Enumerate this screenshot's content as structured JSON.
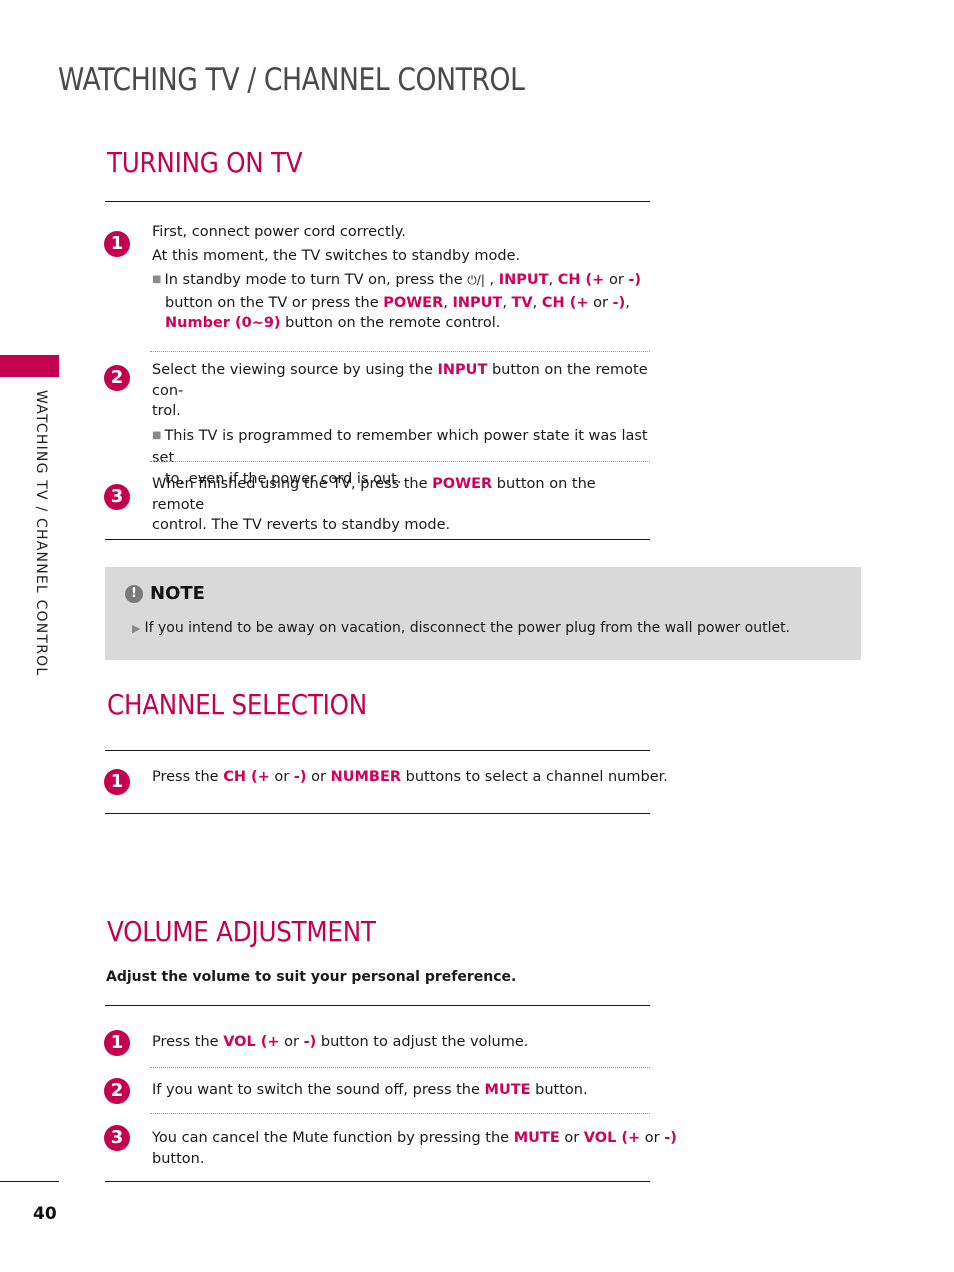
{
  "page": {
    "title": "WATCHING TV / CHANNEL CONTROL",
    "side_label": "WATCHING TV / CHANNEL CONTROL",
    "page_number": "40",
    "accent_color": "#c4004f"
  },
  "turning_on": {
    "title": "TURNING ON TV",
    "steps": [
      {
        "number": "1",
        "line1": "First, connect power cord correctly.",
        "line2": "At this moment, the TV switches to standby mode.",
        "bullet": {
          "p1": "In standby mode to turn TV on, press the ",
          "power_symbol": "⏻/|",
          "p2": " , ",
          "k1": "INPUT",
          "p3": ", ",
          "k2": "CH (+",
          "p4": " or ",
          "k3": "-)",
          "p5": "button on the TV or press the ",
          "k4": "POWER",
          "p6": ", ",
          "k5": "INPUT",
          "p7": ", ",
          "k6": "TV",
          "p8": ", ",
          "k7": "CH (+",
          "p9": " or ",
          "k8": "-)",
          "p10": ",",
          "k9": "Number (0~9)",
          "p11": " button on the remote control."
        }
      },
      {
        "number": "2",
        "p1": "Select the viewing source by using the ",
        "k1": "INPUT",
        "p2": " button on the remote con-",
        "p3": "trol.",
        "bullet_line1": "This TV is programmed to remember which power state it was last set",
        "bullet_line2": "to, even if the power cord is out."
      },
      {
        "number": "3",
        "p1": "When finished using the TV, press the ",
        "k1": "POWER",
        "p2": " button on the remote",
        "p3": "control. The TV reverts to standby mode."
      }
    ]
  },
  "note": {
    "icon": "exclamation-icon",
    "label": "NOTE",
    "text": "If you intend to be away on vacation, disconnect the power plug from the wall power outlet."
  },
  "channel": {
    "title": "CHANNEL SELECTION",
    "step": {
      "number": "1",
      "p1": "Press the ",
      "k1": "CH (+",
      "p2": " or ",
      "k2": "-)",
      "p3": "  or ",
      "k3": "NUMBER",
      "p4": " buttons to select a channel number."
    }
  },
  "volume": {
    "title": "VOLUME ADJUSTMENT",
    "intro": "Adjust the volume to suit your personal preference.",
    "steps": [
      {
        "number": "1",
        "p1": "Press the ",
        "k1": "VOL (+",
        "p2": " or ",
        "k2": "-)",
        "p3": "  button to adjust the volume."
      },
      {
        "number": "2",
        "p1": "If you want to switch the sound off, press the ",
        "k1": "MUTE",
        "p2": " button."
      },
      {
        "number": "3",
        "p1": "You can cancel the Mute function by pressing the ",
        "k1": "MUTE",
        "p2": " or ",
        "k2": "VOL (+",
        "p3": " or ",
        "k3": "-)",
        "p4": "button."
      }
    ]
  }
}
